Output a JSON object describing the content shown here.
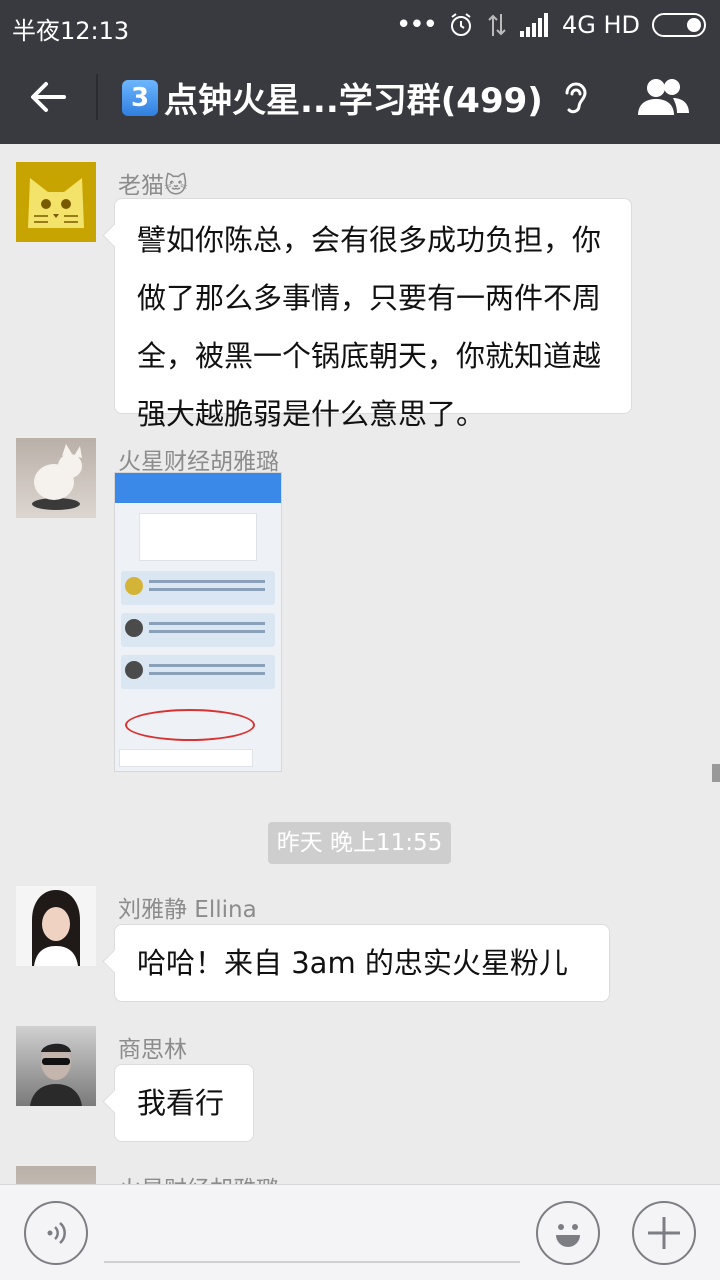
{
  "status_bar": {
    "time": "半夜12:13",
    "network": "4G HD"
  },
  "header": {
    "title_badge": "3",
    "title": "点钟火星...学习群(499)"
  },
  "messages": [
    {
      "sender": "老猫🐱",
      "text": "譬如你陈总，会有很多成功负担，你做了那么多事情，只要有一两件不周全，被黑一个锅底朝天，你就知道越强大越脆弱是什么意思了。"
    },
    {
      "sender": "火星财经胡雅璐"
    },
    {
      "sender": "刘雅静 Ellina",
      "text": "哈哈！来自 3am 的忠实火星粉儿"
    },
    {
      "sender": "商思林",
      "text": "我看行"
    },
    {
      "sender": "火星财经胡雅璐"
    }
  ],
  "time_divider": "昨天 晚上11:55",
  "icons": {
    "back": "arrow-left-icon",
    "ear": "ear-icon",
    "members": "group-members-icon",
    "voice": "voice-icon",
    "emoji": "emoji-icon",
    "plus": "plus-icon"
  }
}
